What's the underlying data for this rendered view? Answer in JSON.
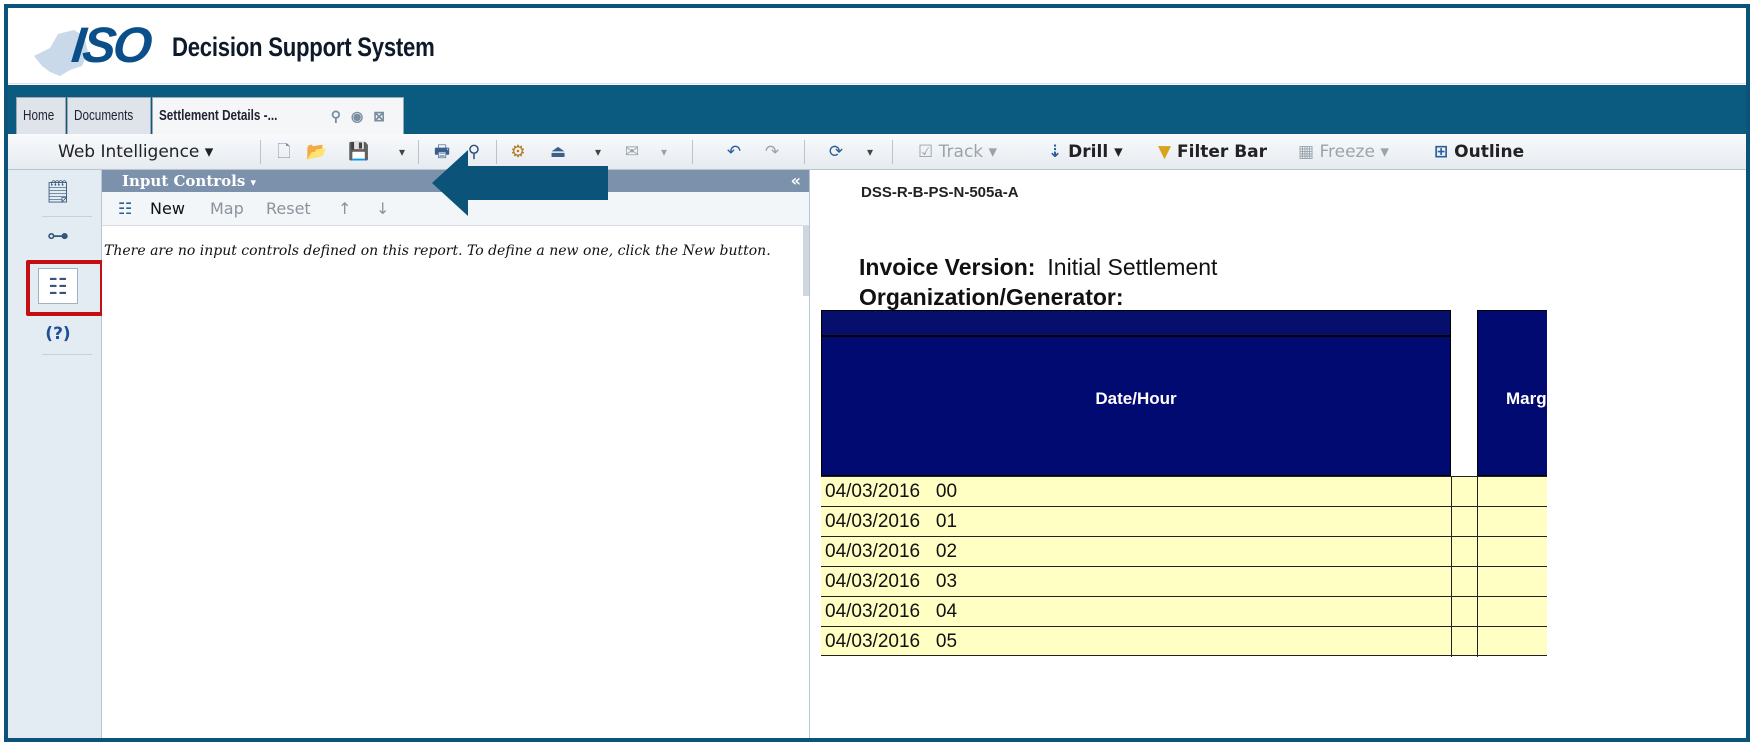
{
  "header": {
    "logo_text": "ISO",
    "app_title": "Decision Support System"
  },
  "tabs": [
    {
      "label": "Home"
    },
    {
      "label": "Documents"
    },
    {
      "label": "Settlement Details -..."
    }
  ],
  "toolbar": {
    "app_menu": "Web Intelligence",
    "track": "Track",
    "drill": "Drill",
    "filter_bar": "Filter Bar",
    "freeze": "Freeze",
    "outline": "Outline"
  },
  "panel": {
    "title": "Input Controls",
    "collapse": "«",
    "tools": {
      "new": "New",
      "map": "Map",
      "reset": "Reset"
    },
    "message": "There are no input controls defined on this report. To define a new one, click the New button."
  },
  "rail": {
    "help": "(?)"
  },
  "report": {
    "report_id": "DSS-R-B-PS-N-505a-A",
    "invoice_label": "Invoice Version:",
    "invoice_value": "Initial Settlement",
    "org_label": "Organization/Generator:",
    "col_date": "Date/Hour",
    "col_marg": "Marg",
    "rows": [
      {
        "date": "04/03/2016   00"
      },
      {
        "date": "04/03/2016   01"
      },
      {
        "date": "04/03/2016   02"
      },
      {
        "date": "04/03/2016   03"
      },
      {
        "date": "04/03/2016   04"
      },
      {
        "date": "04/03/2016   05"
      }
    ]
  },
  "colors": {
    "brand": "#0b5379",
    "highlight": "#c40f12",
    "table_header": "#000a70",
    "row_fill": "#ffffc4"
  }
}
